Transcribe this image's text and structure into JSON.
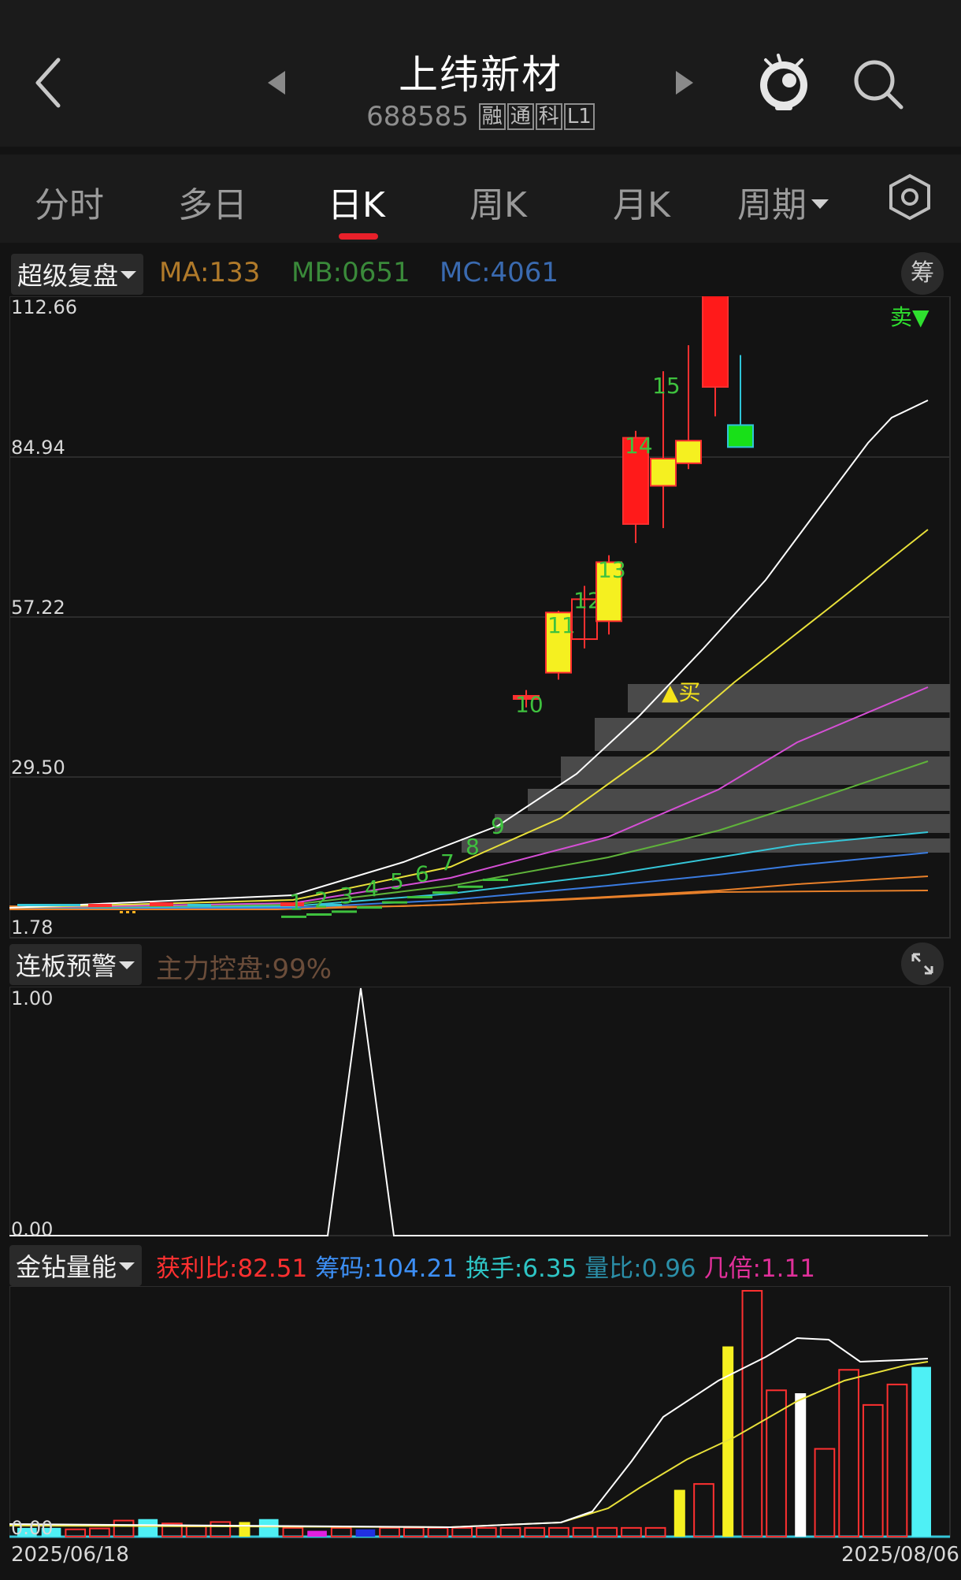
{
  "header": {
    "title": "上纬新材",
    "code": "688585",
    "tags": [
      "融",
      "通",
      "科",
      "L1"
    ]
  },
  "tabs": [
    {
      "label": "分时"
    },
    {
      "label": "多日"
    },
    {
      "label": "日K"
    },
    {
      "label": "周K"
    },
    {
      "label": "月K"
    },
    {
      "label": "周期"
    }
  ],
  "kline_panel": {
    "indicator_name": "超级复盘",
    "ma": {
      "label": "MA:133",
      "color": "#b07a2a"
    },
    "mb": {
      "label": "MB:0651",
      "color": "#3a8a3a"
    },
    "mc": {
      "label": "MC:4061",
      "color": "#3a6ab0"
    },
    "chip_button": "筹",
    "y_labels": [
      "112.66",
      "84.94",
      "57.22",
      "29.50",
      "1.78"
    ],
    "buy_label": "▲买",
    "sell_label": "卖▼",
    "count_labels": [
      "1",
      "2",
      "3",
      "4",
      "5",
      "6",
      "7",
      "8",
      "9",
      "10",
      "11",
      "12",
      "13",
      "14",
      "15"
    ]
  },
  "warning_panel": {
    "indicator_name": "连板预警",
    "info": "主力控盘:99%",
    "y_labels": [
      "1.00",
      "0.00"
    ]
  },
  "volume_panel": {
    "indicator_name": "金钻量能",
    "stats": [
      {
        "text": "获利比:82.51",
        "color": "#ff3030"
      },
      {
        "text": "筹码:104.21",
        "color": "#3d8ff5"
      },
      {
        "text": "换手:6.35",
        "color": "#2ec4c4"
      },
      {
        "text": "量比:0.96",
        "color": "#2b8fa8"
      },
      {
        "text": "几倍:1.11",
        "color": "#e0309a"
      }
    ],
    "zero_label": "0.00",
    "date_start": "2025/06/18",
    "date_end": "2025/08/06"
  },
  "chart_data": {
    "type": "candlestick",
    "y_range": [
      1.78,
      112.66
    ],
    "candles": [
      {
        "n": "1",
        "open": 5.2,
        "close": 5.4,
        "high": 6.6,
        "low": 4.8,
        "color": "green-label"
      },
      {
        "n": "2",
        "open": 5.6,
        "close": 5.8,
        "high": 7.0,
        "low": 5.2
      },
      {
        "n": "3",
        "open": 6.0,
        "close": 6.3,
        "high": 7.8,
        "low": 5.8
      },
      {
        "n": "4",
        "open": 6.7,
        "close": 7.0,
        "high": 9.0,
        "low": 6.4
      },
      {
        "n": "5",
        "open": 7.4,
        "close": 7.9,
        "high": 10.2,
        "low": 7.1
      },
      {
        "n": "6",
        "open": 8.3,
        "close": 8.8,
        "high": 11.5,
        "low": 8.0
      },
      {
        "n": "7",
        "open": 9.2,
        "close": 9.6,
        "high": 13.5,
        "low": 9.0
      },
      {
        "n": "8",
        "open": 10.2,
        "close": 10.6,
        "high": 16.2,
        "low": 10.0
      },
      {
        "n": "9",
        "open": 11.2,
        "close": 11.8,
        "high": 19.8,
        "low": 11.0
      },
      {
        "n": "10",
        "open": 43.2,
        "close": 43.6,
        "high": 44.6,
        "low": 41.6
      },
      {
        "n": "11",
        "open": 47.6,
        "close": 58.0,
        "high": 58.3,
        "low": 46.4
      },
      {
        "n": "12",
        "open": 60.3,
        "close": 53.4,
        "high": 62.6,
        "low": 51.8
      },
      {
        "n": "13",
        "open": 56.5,
        "close": 66.7,
        "high": 67.9,
        "low": 54.2
      },
      {
        "n": "14",
        "open": 73.3,
        "close": 88.2,
        "high": 89.4,
        "low": 70.0
      },
      {
        "n": "15",
        "open": 79.9,
        "close": 84.6,
        "high": 99.7,
        "low": 72.6
      },
      {
        "n": "16",
        "open": 83.8,
        "close": 87.7,
        "high": 104.2,
        "low": 82.8
      },
      {
        "n": "17",
        "open": 113.0,
        "close": 97.0,
        "high": 113.0,
        "low": 91.9
      },
      {
        "n": "18",
        "open": 86.6,
        "close": 90.4,
        "high": 102.5,
        "low": 86.6
      }
    ],
    "ma_lines": [
      {
        "name": "white",
        "color": "#ffffff"
      },
      {
        "name": "yellow",
        "color": "#e8e03a"
      },
      {
        "name": "magenta",
        "color": "#d64fd6"
      },
      {
        "name": "green",
        "color": "#5fb33a"
      },
      {
        "name": "cyan",
        "color": "#35c6d8"
      },
      {
        "name": "blue",
        "color": "#3a7be0"
      },
      {
        "name": "orange",
        "color": "#e8802a"
      }
    ],
    "warning_series": {
      "values_peak": 1.0,
      "base": 0.0
    },
    "volume_bars": [
      {
        "value": 0.3,
        "color": "cyan"
      },
      {
        "value": 0.3,
        "color": "cyan"
      },
      {
        "value": 0.25,
        "color": "red"
      },
      {
        "value": 0.28,
        "color": "red"
      },
      {
        "value": 0.55,
        "color": "red"
      },
      {
        "value": 0.6,
        "color": "cyan"
      },
      {
        "value": 0.45,
        "color": "red"
      },
      {
        "value": 0.35,
        "color": "red"
      },
      {
        "value": 0.5,
        "color": "red"
      },
      {
        "value": 0.5,
        "color": "yellow"
      },
      {
        "value": 0.6,
        "color": "cyan"
      },
      {
        "value": 0.3,
        "color": "red"
      },
      {
        "value": 0.2,
        "color": "magenta"
      },
      {
        "value": 0.3,
        "color": "red"
      },
      {
        "value": 0.25,
        "color": "blue"
      },
      {
        "value": 0.3,
        "color": "red"
      },
      {
        "value": 0.3,
        "color": "red"
      },
      {
        "value": 0.3,
        "color": "red"
      },
      {
        "value": 0.3,
        "color": "red"
      },
      {
        "value": 0.3,
        "color": "red"
      },
      {
        "value": 0.3,
        "color": "red"
      },
      {
        "value": 0.3,
        "color": "red"
      },
      {
        "value": 0.3,
        "color": "red"
      },
      {
        "value": 0.3,
        "color": "red"
      },
      {
        "value": 0.3,
        "color": "red"
      },
      {
        "value": 0.3,
        "color": "red"
      },
      {
        "value": 0.3,
        "color": "red"
      },
      {
        "value": 1.6,
        "color": "yellow"
      },
      {
        "value": 1.8,
        "color": "red"
      },
      {
        "value": 6.5,
        "color": "yellow"
      },
      {
        "value": 8.4,
        "color": "red"
      },
      {
        "value": 5.0,
        "color": "red"
      },
      {
        "value": 4.9,
        "color": "white"
      },
      {
        "value": 3.0,
        "color": "red"
      },
      {
        "value": 5.7,
        "color": "red"
      },
      {
        "value": 4.5,
        "color": "red"
      },
      {
        "value": 5.2,
        "color": "red"
      },
      {
        "value": 5.8,
        "color": "cyan"
      }
    ]
  }
}
